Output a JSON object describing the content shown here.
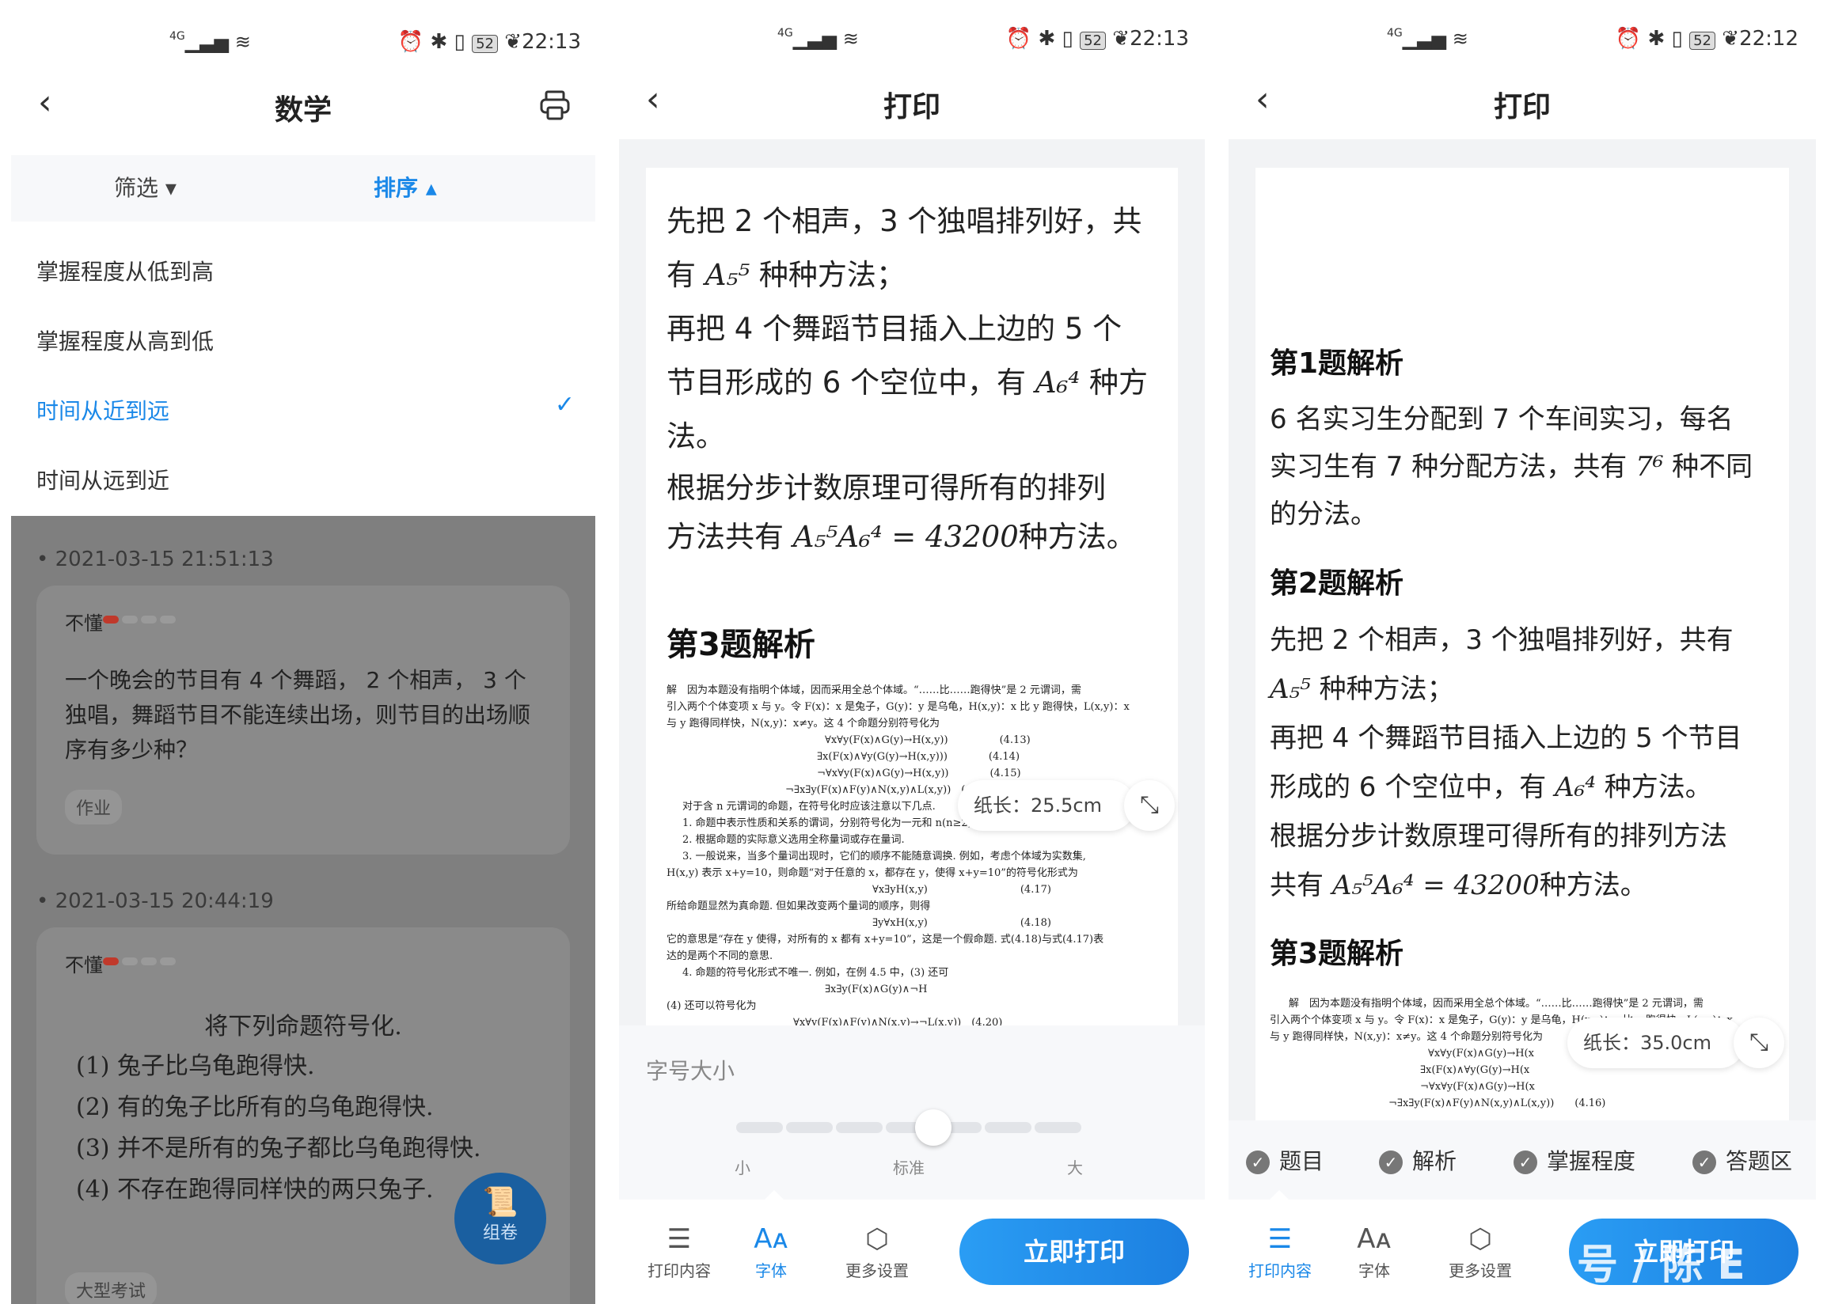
{
  "phone1": {
    "status": {
      "signal": "4G",
      "battery": "52",
      "time": "22:13"
    },
    "title": "数学",
    "filter_label": "筛选 ▾",
    "sort_label": "排序 ▴",
    "sort_options": [
      "掌握程度从低到高",
      "掌握程度从高到低",
      "时间从近到远",
      "时间从远到近"
    ],
    "selected_option": "时间从近到远",
    "cards": [
      {
        "time": "2021-03-15 21:51:13",
        "level": "不懂",
        "text": "一个晚会的节目有 4 个舞蹈， 2 个相声， 3 个独唱，舞蹈节目不能连续出场，则节目的出场顺序有多少种？",
        "tag": "作业"
      },
      {
        "time": "2021-03-15 20:44:19",
        "level": "不懂",
        "heading": "将下列命题符号化.",
        "lines": [
          "(1) 兔子比乌龟跑得快.",
          "(2) 有的兔子比所有的乌龟跑得快.",
          "(3) 并不是所有的兔子都比乌龟跑得快.",
          "(4) 不存在跑得同样快的两只兔子."
        ],
        "tag": "大型考试"
      }
    ],
    "fab_label": "组卷"
  },
  "phone2": {
    "status": {
      "signal": "4G",
      "battery": "52",
      "time": "22:13"
    },
    "title": "打印",
    "para1_line1": "先把 2 个相声，3 个独唱排列好，共",
    "para1_line2a": "有",
    "para1_math1": "A₅⁵",
    "para1_line2b": "种种方法；",
    "para2_line1": "再把 4 个舞蹈节目插入上边的 5 个",
    "para2_line2a": "节目形成的 6 个空位中，有",
    "para2_math": "A₆⁴",
    "para2_line2b": "种方",
    "para2_line3": "法。",
    "para3_line1": "根据分步计数原理可得所有的排列",
    "para3_line2a": "方法共有",
    "para3_math": "A₅⁵A₆⁴ = 43200",
    "para3_line2b": "种方法。",
    "heading3": "第3题解析",
    "doc_lines": [
      "解　因为本题没有指明个体域，因而采用全总个体域。“……比……跑得快”是 2 元谓词，需",
      "引入两个个体变项 x 与 y。令 F(x)：x 是兔子，G(y)：y 是乌龟，H(x,y)：x 比 y 跑得快，L(x,y)：x",
      "与 y 跑得同样快，N(x,y)：x≠y。这 4 个命题分别符号化为",
      "∀x∀y(F(x)∧G(y)→H(x,y))　　　　　(4.13)",
      "∃x(F(x)∧∀y(G(y)→H(x,y)))　　　　(4.14)",
      "¬∀x∀y(F(x)∧G(y)→H(x,y))　　　　(4.15)",
      "¬∃x∃y(F(x)∧F(y)∧N(x,y)∧L(x,y))　(4.16)",
      "对于含 n 元谓词的命题，在符号化时应该注意以下几点.",
      "1. 命题中表示性质和关系的谓词，分别符号化为一元和 n(n≥2) 元谓词.",
      "2. 根据命题的实际意义选用全称量词或存在量词.",
      "3. 一般说来，当多个量词出现时，它们的顺序不能随意调换. 例如，考虑个体域为实数集,",
      "H(x,y) 表示 x+y=10，则命题“对于任意的 x，都存在 y，使得 x+y=10”的符号化形式为",
      "∀x∃yH(x,y)　　　　　　　　　(4.17)",
      "所给命题显然为真命题. 但如果改变两个量词的顺序，则得",
      "∃y∀xH(x,y)　　　　　　　　　(4.18)",
      "它的意思是“存在 y 使得，对所有的 x 都有 x+y=10”，这是一个假命题. 式(4.18)与式(4.17)表",
      "达的是两个不同的意思.",
      "4. 命题的符号化形式不唯一. 例如，在例 4.5 中，(3) 还可",
      "∃x∃y(F(x)∧G(y)∧¬H",
      "(4) 还可以符号化为",
      "∀x∀y(F(x)∧F(y)∧N(x,y)→¬L(x,y))　(4.20)"
    ],
    "paper_length": "纸长：25.5cm",
    "font_size_label": "字号大小",
    "slider": {
      "labels": [
        "小",
        "标准",
        "大"
      ],
      "value_step": 4,
      "steps": 7
    },
    "tabs": [
      "打印内容",
      "字体",
      "更多设置"
    ],
    "active_tab": "字体",
    "print_button": "立即打印"
  },
  "phone3": {
    "status": {
      "signal": "4G",
      "battery": "52",
      "time": "22:12"
    },
    "title": "打印",
    "h1": "第1题解析",
    "p1_line1": "6 名实习生分配到 7 个车间实习，每名",
    "p1_line2a": "实习生有 7 种分配方法，共有",
    "p1_math": "7⁶",
    "p1_line2b": "种不同",
    "p1_line3": "的分法。",
    "h2": "第2题解析",
    "p2_line1": "先把 2 个相声，3 个独唱排列好，共有",
    "p2_math1": "A₅⁵",
    "p2_line2b": "种种方法；",
    "p2_line3": "再把 4 个舞蹈节目插入上边的 5 个节目",
    "p2_line4a": "形成的 6 个空位中，有",
    "p2_math2": "A₆⁴",
    "p2_line4b": "种方法。",
    "p2_line5": "根据分步计数原理可得所有的排列方法",
    "p2_line6a": "共有",
    "p2_math3": "A₅⁵A₆⁴ = 43200",
    "p2_line6b": "种方法。",
    "h3": "第3题解析",
    "doc_lines": [
      "解　因为本题没有指明个体域，因而采用全总个体域。“……比……跑得快”是 2 元谓词，需",
      "引入两个个体变项 x 与 y。令 F(x)：x 是兔子，G(y)：y 是乌龟，H(x,y)：x 比 y 跑得快，L(x,y)：x",
      "与 y 跑得同样快，N(x,y)：x≠y。这 4 个命题分别符号化为",
      "∀x∀y(F(x)∧G(y)→H(x",
      "∃x(F(x)∧∀y(G(y)→H(x",
      "¬∀x∀y(F(x)∧G(y)→H(x",
      "¬∃x∃y(F(x)∧F(y)∧N(x,y)∧L(x,y))　　(4.16)"
    ],
    "paper_length": "纸长：35.0cm",
    "options": [
      "题目",
      "解析",
      "掌握程度",
      "答题区"
    ],
    "tabs": [
      "打印内容",
      "字体",
      "更多设置"
    ],
    "active_tab": "打印内容",
    "print_button": "立即打印",
    "watermark": "号 / 陈 E"
  },
  "colors": {
    "accent": "#1a88e8",
    "overlay": "#7f7f7f",
    "gray_bg": "#f2f3f5"
  }
}
